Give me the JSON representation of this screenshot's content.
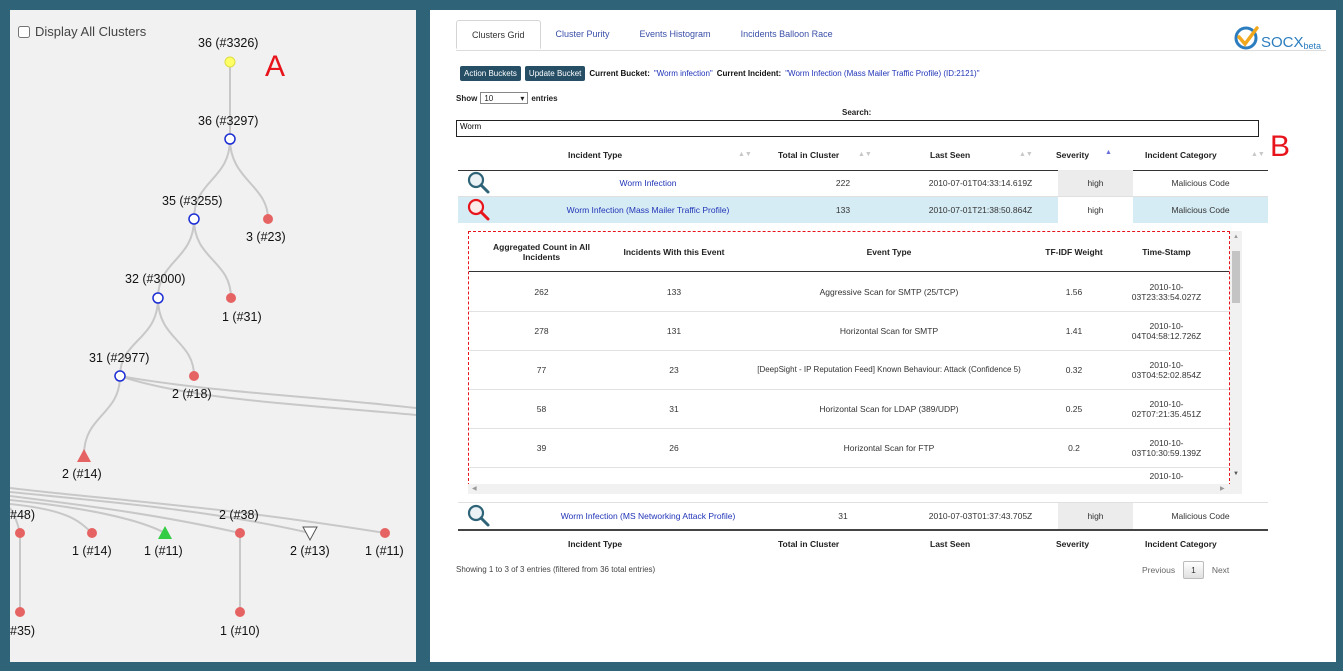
{
  "panel_a": {
    "letter": "A",
    "display_all_clusters": "Display All Clusters",
    "nodes": [
      {
        "label": "36 (#3326)"
      },
      {
        "label": "36 (#3297)"
      },
      {
        "label": "35 (#3255)"
      },
      {
        "label": "3 (#23)"
      },
      {
        "label": "32 (#3000)"
      },
      {
        "label": "1 (#31)"
      },
      {
        "label": "31 (#2977)"
      },
      {
        "label": "2 (#18)"
      },
      {
        "label": "2 (#14)"
      },
      {
        "label": "#48)"
      },
      {
        "label": "1 (#14)"
      },
      {
        "label": "1 (#11)"
      },
      {
        "label": "2 (#38)"
      },
      {
        "label": "2 (#13)"
      },
      {
        "label": "1 (#11)"
      },
      {
        "label": "#35)"
      },
      {
        "label": "1 (#10)"
      }
    ]
  },
  "panel_b": {
    "letter": "B",
    "tabs": [
      "Clusters Grid",
      "Cluster Purity",
      "Events Histogram",
      "Incidents Balloon Race"
    ],
    "logo": {
      "text": "SOCX",
      "sub": "beta"
    },
    "buttons": {
      "action": "Action Buckets",
      "update": "Update Bucket"
    },
    "current_bucket_label": "Current Bucket:",
    "current_bucket_value": "\"Worm infection\"",
    "current_incident_label": "Current Incident:",
    "current_incident_value": "\"Worm Infection (Mass Mailer Traffic Profile) (ID:2121)\"",
    "show_label": "Show",
    "show_value": "10",
    "entries_label": "entries",
    "search_label": "Search:",
    "search_value": "Worm",
    "columns": [
      "Incident Type",
      "Total in Cluster",
      "Last Seen",
      "Severity",
      "Incident Category"
    ],
    "rows": [
      {
        "type": "Worm Infection",
        "total": "222",
        "last_seen": "2010-07-01T04:33:14.619Z",
        "severity": "high",
        "category": "Malicious Code"
      },
      {
        "type": "Worm Infection (Mass Mailer Traffic Profile)",
        "total": "133",
        "last_seen": "2010-07-01T21:38:50.864Z",
        "severity": "high",
        "category": "Malicious Code"
      },
      {
        "type": "Worm Infection (MS Networking Attack Profile)",
        "total": "31",
        "last_seen": "2010-07-03T01:37:43.705Z",
        "severity": "high",
        "category": "Malicious Code"
      }
    ],
    "nested_columns": [
      "Aggregated Count in All Incidents",
      "Incidents With this Event",
      "Event Type",
      "TF-IDF Weight",
      "Time-Stamp"
    ],
    "nested_rows": [
      {
        "agg": "262",
        "inc": "133",
        "event": "Aggressive Scan for SMTP (25/TCP)",
        "tfidf": "1.56",
        "ts": "2010-10-03T23:33:54.027Z"
      },
      {
        "agg": "278",
        "inc": "131",
        "event": "Horizontal Scan for SMTP",
        "tfidf": "1.41",
        "ts": "2010-10-04T04:58:12.726Z"
      },
      {
        "agg": "77",
        "inc": "23",
        "event": "[DeepSight - IP Reputation Feed] Known Behaviour: Attack (Confidence 5)",
        "tfidf": "0.32",
        "ts": "2010-10-03T04:52:02.854Z"
      },
      {
        "agg": "58",
        "inc": "31",
        "event": "Horizontal Scan for LDAP (389/UDP)",
        "tfidf": "0.25",
        "ts": "2010-10-02T07:21:35.451Z"
      },
      {
        "agg": "39",
        "inc": "26",
        "event": "Horizontal Scan for FTP",
        "tfidf": "0.2",
        "ts": "2010-10-03T10:30:59.139Z"
      },
      {
        "agg": "",
        "inc": "",
        "event": "",
        "tfidf": "",
        "ts": "2010-10-"
      }
    ],
    "footer_info": "Showing 1 to 3 of 3 entries (filtered from 36 total entries)",
    "pager": {
      "previous": "Previous",
      "page": "1",
      "next": "Next"
    },
    "colors": {
      "accent": "#2f6478",
      "link": "#2034b8",
      "highlight": "#e8141c",
      "selected_row": "#d6ecf4"
    }
  }
}
